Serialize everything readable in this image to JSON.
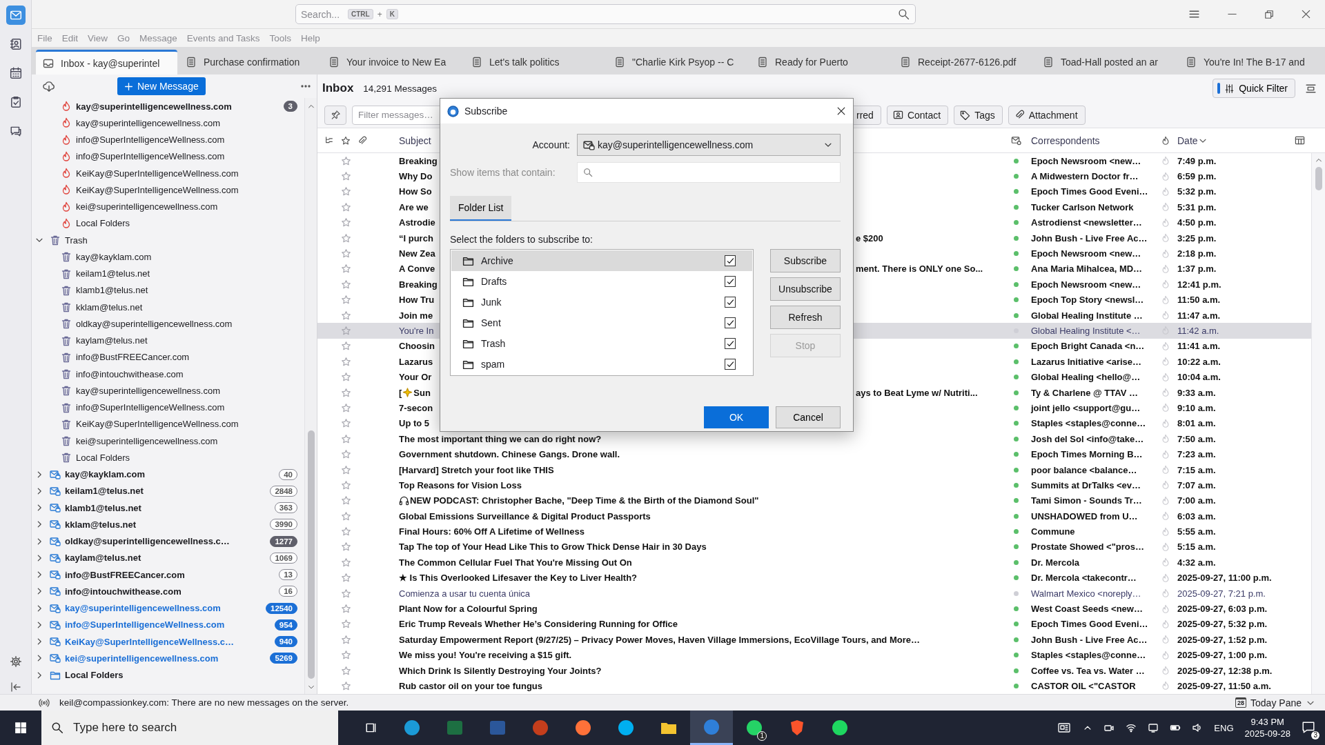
{
  "topbar": {
    "search_placeholder": "Search...",
    "shortcut": {
      "keys": [
        "CTRL",
        "K"
      ],
      "joiner": "+"
    }
  },
  "menu": [
    "File",
    "Edit",
    "View",
    "Go",
    "Message",
    "Events and Tasks",
    "Tools",
    "Help"
  ],
  "spaces_bar": {
    "items": [
      {
        "kind": "mail",
        "selected": true
      },
      {
        "kind": "contacts",
        "selected": false
      },
      {
        "kind": "calendar",
        "selected": false
      },
      {
        "kind": "tasks",
        "selected": false
      },
      {
        "kind": "chat",
        "selected": false
      }
    ]
  },
  "tabs": [
    {
      "kind": "folder",
      "label": "Inbox - kay@superintel",
      "selected": true
    },
    {
      "kind": "message",
      "label": "Purchase confirmation",
      "selected": false
    },
    {
      "kind": "message",
      "label": "Your invoice to New Ea",
      "selected": false
    },
    {
      "kind": "message",
      "label": "Let's talk politics",
      "selected": false
    },
    {
      "kind": "message",
      "label": "\"Charlie Kirk Psyop -- C",
      "selected": false
    },
    {
      "kind": "message",
      "label": "Ready for Puerto",
      "selected": false
    },
    {
      "kind": "message",
      "label": "Receipt-2677-6126.pdf",
      "selected": false
    },
    {
      "kind": "message",
      "label": "Toad-Hall posted an ar",
      "selected": false
    },
    {
      "kind": "message",
      "label": "You're In! The B-17 and",
      "selected": false
    }
  ],
  "folder_pane": {
    "new_message": "New Message",
    "folders": [
      {
        "children": [
          {
            "kind": "junk",
            "label": "kay@superintelligencewellness.com",
            "unread": true,
            "count": "3",
            "color": "#5f5f6a"
          },
          {
            "kind": "junk",
            "label": "kay@superintelligencewellness.com",
            "unread": false
          },
          {
            "kind": "junk",
            "label": "info@SuperIntelligenceWellness.com",
            "unread": false
          },
          {
            "kind": "junk",
            "label": "info@SuperIntelligenceWellness.com",
            "unread": false
          },
          {
            "kind": "junk",
            "label": "KeiKay@SuperIntelligenceWellness.com",
            "unread": false
          },
          {
            "kind": "junk",
            "label": "KeiKay@SuperIntelligenceWellness.com",
            "unread": false
          },
          {
            "kind": "junk",
            "label": "kei@superintelligencewellness.com",
            "unread": false
          },
          {
            "kind": "junk",
            "label": "Local Folders",
            "unread": false
          }
        ]
      },
      {
        "kind": "trash",
        "label": "Trash",
        "unread": false,
        "new_mail": false,
        "expanded": true,
        "children": [
          {
            "kind": "trash",
            "label": "kay@kayklam.com",
            "unread": false
          },
          {
            "kind": "trash",
            "label": "keilam1@telus.net",
            "unread": false
          },
          {
            "kind": "trash",
            "label": "klamb1@telus.net",
            "unread": false
          },
          {
            "kind": "trash",
            "label": "kklam@telus.net",
            "unread": false
          },
          {
            "kind": "trash",
            "label": "oldkay@superintelligencewellness.com",
            "unread": false
          },
          {
            "kind": "trash",
            "label": "kaylam@telus.net",
            "unread": false
          },
          {
            "kind": "trash",
            "label": "info@BustFREECancer.com",
            "unread": false
          },
          {
            "kind": "trash",
            "label": "info@intouchwithease.com",
            "unread": false
          },
          {
            "kind": "trash",
            "label": "kay@superintelligencewellness.com",
            "unread": false
          },
          {
            "kind": "trash",
            "label": "info@SuperIntelligenceWellness.com",
            "unread": false
          },
          {
            "kind": "trash",
            "label": "KeiKay@SuperIntelligenceWellness.com",
            "unread": false
          },
          {
            "kind": "trash",
            "label": "kei@superintelligencewellness.com",
            "unread": false
          },
          {
            "kind": "trash",
            "label": "Local Folders",
            "unread": false
          }
        ]
      },
      {
        "kind": "account",
        "label": "kay@kayklam.com",
        "unread": true,
        "new_mail": false,
        "expanded": false,
        "count": "40"
      },
      {
        "kind": "account",
        "label": "keilam1@telus.net",
        "unread": true,
        "new_mail": false,
        "expanded": false,
        "count": "2848"
      },
      {
        "kind": "account",
        "label": "klamb1@telus.net",
        "unread": true,
        "new_mail": false,
        "expanded": false,
        "count": "363"
      },
      {
        "kind": "account",
        "label": "kklam@telus.net",
        "unread": true,
        "new_mail": false,
        "expanded": false,
        "count": "3990"
      },
      {
        "kind": "account",
        "label": "oldkay@superintelligencewellness.c…",
        "unread": true,
        "new_mail": false,
        "expanded": false,
        "count": "1277",
        "color": "#5f5f6a"
      },
      {
        "kind": "account",
        "label": "kaylam@telus.net",
        "unread": true,
        "new_mail": false,
        "expanded": false,
        "count": "1069"
      },
      {
        "kind": "account",
        "label": "info@BustFREECancer.com",
        "unread": true,
        "new_mail": false,
        "expanded": false,
        "count": "13"
      },
      {
        "kind": "account",
        "label": "info@intouchwithease.com",
        "unread": true,
        "new_mail": false,
        "expanded": false,
        "count": "16"
      },
      {
        "kind": "account",
        "label": "kay@superintelligencewellness.com",
        "unread": true,
        "new_mail": true,
        "expanded": false,
        "count": "12540",
        "color": "#1b6fd6"
      },
      {
        "kind": "account",
        "label": "info@SuperIntelligenceWellness.com",
        "unread": true,
        "new_mail": true,
        "expanded": false,
        "count": "954",
        "color": "#1b6fd6"
      },
      {
        "kind": "account",
        "label": "KeiKay@SuperIntelligenceWellness.c…",
        "unread": true,
        "new_mail": true,
        "expanded": false,
        "count": "940",
        "color": "#1b6fd6"
      },
      {
        "kind": "account",
        "label": "kei@superintelligencewellness.com",
        "unread": true,
        "new_mail": true,
        "expanded": false,
        "count": "5269",
        "color": "#1b6fd6"
      },
      {
        "kind": "local",
        "label": "Local Folders",
        "unread": true,
        "new_mail": false,
        "expanded": false
      }
    ]
  },
  "message_pane": {
    "title": "Inbox",
    "count": "14,291 Messages",
    "quick_filter": {
      "label": "Quick Filter",
      "on": true
    },
    "filter_placeholder": "Filter messages…",
    "filter_buttons": [
      {
        "kind": "starred",
        "label": "rred"
      },
      {
        "kind": "contact",
        "label": "Contact"
      },
      {
        "kind": "tags",
        "label": "Tags"
      },
      {
        "kind": "attachment",
        "label": "Attachment"
      }
    ],
    "columns": {
      "subject": "Subject",
      "correspondents": "Correspondents",
      "date": "Date"
    },
    "rows": [
      {
        "kind": "text",
        "subject": "Breaking",
        "correspondent": "Epoch Newsroom <new…",
        "date": "7:49 p.m.",
        "unread": true,
        "selected": false
      },
      {
        "kind": "text",
        "subject": "Why Do",
        "correspondent": "A Midwestern Doctor fr…",
        "date": "6:59 p.m.",
        "unread": true,
        "selected": false
      },
      {
        "kind": "text",
        "subject": "How So",
        "correspondent": "Epoch Times Good Eveni…",
        "date": "5:32 p.m.",
        "unread": true,
        "selected": false
      },
      {
        "kind": "text",
        "subject": "Are we",
        "correspondent": "Tucker Carlson Network",
        "date": "5:31 p.m.",
        "unread": true,
        "selected": false
      },
      {
        "kind": "text",
        "subject": "Astrodie",
        "correspondent": "Astrodienst <newsletter…",
        "date": "4:50 p.m.",
        "unread": true,
        "selected": false
      },
      {
        "kind": "text",
        "subject": "“I purch",
        "tail": "e $200",
        "correspondent": "John Bush - Live Free Ac…",
        "date": "3:25 p.m.",
        "unread": true,
        "selected": false
      },
      {
        "kind": "text",
        "subject": "New Zea",
        "correspondent": "Epoch Newsroom <new…",
        "date": "2:18 p.m.",
        "unread": true,
        "selected": false
      },
      {
        "kind": "text",
        "subject": "A Conve",
        "tail": "ment. There is ONLY one So...",
        "correspondent": "Ana Maria Mihalcea, MD…",
        "date": "1:37 p.m.",
        "unread": true,
        "selected": false
      },
      {
        "kind": "text",
        "subject": "Breaking",
        "correspondent": "Epoch Newsroom <new…",
        "date": "12:41 p.m.",
        "unread": true,
        "selected": false
      },
      {
        "kind": "text",
        "subject": "How Tru",
        "correspondent": "Epoch Top Story <newsl…",
        "date": "11:50 a.m.",
        "unread": true,
        "selected": false
      },
      {
        "kind": "text",
        "subject": "Join me",
        "correspondent": "Global Healing Institute …",
        "date": "11:47 a.m.",
        "unread": true,
        "selected": false
      },
      {
        "kind": "text",
        "subject": "You're In",
        "correspondent": "Global Healing Institute <…",
        "date": "11:42 a.m.",
        "unread": false,
        "selected": true
      },
      {
        "kind": "text",
        "subject": "Choosin",
        "correspondent": "Epoch Bright Canada <n…",
        "date": "11:41 a.m.",
        "unread": true,
        "selected": false
      },
      {
        "kind": "text",
        "subject": "Lazarus",
        "correspondent": "Lazarus Initiative <arise…",
        "date": "10:22 a.m.",
        "unread": true,
        "selected": false
      },
      {
        "kind": "text",
        "subject": "Your Or",
        "correspondent": "Global Healing <hello@…",
        "date": "10:04 a.m.",
        "unread": true,
        "selected": false
      },
      {
        "kind": "sparkle",
        "lead": "[",
        "subject": "Sun",
        "tail": "ays to Beat Lyme w/ Nutriti...",
        "correspondent": "Ty & Charlene @ TTAV …",
        "date": "9:33 a.m.",
        "unread": true,
        "selected": false
      },
      {
        "kind": "text",
        "subject": "7-secon",
        "correspondent": "joint jello <support@gu…",
        "date": "9:10 a.m.",
        "unread": true,
        "selected": false
      },
      {
        "kind": "text",
        "subject": "Up to 5",
        "correspondent": "Staples <staples@conne…",
        "date": "8:01 a.m.",
        "unread": true,
        "selected": false
      },
      {
        "kind": "text",
        "subject": "The most important thing we can do right now?",
        "correspondent": "Josh del Sol <info@take…",
        "date": "7:50 a.m.",
        "unread": true,
        "selected": false
      },
      {
        "kind": "text",
        "subject": "Government shutdown. Chinese Gangs. Drone wall.",
        "correspondent": "Epoch Times Morning B…",
        "date": "7:23 a.m.",
        "unread": true,
        "selected": false
      },
      {
        "kind": "text",
        "subject": "[Harvard] Stretch your foot like THIS",
        "correspondent": "poor balance <balance…",
        "date": "7:15 a.m.",
        "unread": true,
        "selected": false
      },
      {
        "kind": "text",
        "subject": "Top Reasons for Vision Loss",
        "correspondent": "Summits at DrTalks <ev…",
        "date": "7:07 a.m.",
        "unread": true,
        "selected": false
      },
      {
        "kind": "headphones",
        "subject": "NEW PODCAST: Christopher Bache, \"Deep Time & the Birth of the Diamond Soul\"",
        "correspondent": "Tami Simon - Sounds Tr…",
        "date": "7:00 a.m.",
        "unread": true,
        "selected": false
      },
      {
        "kind": "text",
        "subject": "Global Emissions Surveillance & Digital Product Passports",
        "correspondent": "UNSHADOWED from U…",
        "date": "6:03 a.m.",
        "unread": true,
        "selected": false
      },
      {
        "kind": "text",
        "subject": "Final Hours: 60% Off A Lifetime of Wellness",
        "correspondent": "Commune",
        "date": "5:55 a.m.",
        "unread": true,
        "selected": false
      },
      {
        "kind": "text",
        "subject": "Tap The top of Your Head Like This to Grow Thick Dense Hair in 30 Days",
        "correspondent": "Prostate Showed <\"pros…",
        "date": "5:15 a.m.",
        "unread": true,
        "selected": false
      },
      {
        "kind": "text",
        "subject": "The Common Cellular Fuel That You're Missing Out On",
        "correspondent": "Dr. Mercola",
        "date": "4:32 a.m.",
        "unread": true,
        "selected": false
      },
      {
        "kind": "text",
        "subject": "★ Is This Overlooked Lifesaver the Key to Liver Health?",
        "correspondent": "Dr. Mercola <takecontr…",
        "date": "2025-09-27, 11:00 p.m.",
        "unread": true,
        "selected": false
      },
      {
        "kind": "text",
        "subject": "Comienza a usar tu cuenta única",
        "correspondent": "Walmart Mexico <noreply…",
        "date": "2025-09-27, 7:21 p.m.",
        "unread": false,
        "selected": false
      },
      {
        "kind": "text",
        "subject": "Plant Now for a Colourful Spring",
        "correspondent": "West Coast Seeds <new…",
        "date": "2025-09-27, 6:03 p.m.",
        "unread": true,
        "selected": false
      },
      {
        "kind": "text",
        "subject": "Eric Trump Reveals Whether He’s Considering Running for Office",
        "correspondent": "Epoch Times Good Eveni…",
        "date": "2025-09-27, 5:32 p.m.",
        "unread": true,
        "selected": false
      },
      {
        "kind": "text",
        "subject": "Saturday Empowerment Report (9/27/25) – Privacy Power Moves, Haven Village Immersions, EcoVillage Tours, and More…",
        "correspondent": "John Bush - Live Free Ac…",
        "date": "2025-09-27, 1:52 p.m.",
        "unread": true,
        "selected": false
      },
      {
        "kind": "text",
        "subject": "We miss you! You're receiving a $15 gift.",
        "correspondent": "Staples <staples@conne…",
        "date": "2025-09-27, 1:00 p.m.",
        "unread": true,
        "selected": false
      },
      {
        "kind": "text",
        "subject": "Which Drink Is Silently Destroying Your Joints?",
        "correspondent": "Coffee vs. Tea vs. Water …",
        "date": "2025-09-27, 12:38 p.m.",
        "unread": true,
        "selected": false
      },
      {
        "kind": "text",
        "subject": "Rub castor oil on your toe fungus",
        "correspondent": "CASTOR OIL <\"CASTOR",
        "date": "2025-09-27, 11:50 a.m.",
        "unread": true,
        "selected": false
      }
    ]
  },
  "dialog": {
    "title": "Subscribe",
    "account_label": "Account:",
    "account": "kay@superintelligencewellness.com",
    "filter_label": "Show items that contain:",
    "tabs": [
      {
        "label": "Folder List",
        "selected": true
      }
    ],
    "instruction": "Select the folders to subscribe to:",
    "folders": [
      {
        "label": "Archive",
        "checked": true,
        "selected": true
      },
      {
        "label": "Drafts",
        "checked": true,
        "selected": false
      },
      {
        "label": "Junk",
        "checked": true,
        "selected": false
      },
      {
        "label": "Sent",
        "checked": true,
        "selected": false
      },
      {
        "label": "Trash",
        "checked": true,
        "selected": false
      },
      {
        "label": "spam",
        "checked": true,
        "selected": false
      }
    ],
    "buttons": [
      {
        "label": "Subscribe",
        "disabled": false
      },
      {
        "label": "Unsubscribe",
        "disabled": false
      },
      {
        "label": "Refresh",
        "disabled": false
      },
      {
        "label": "Stop",
        "disabled": true
      }
    ],
    "ok": "OK",
    "cancel": "Cancel"
  },
  "status_bar": {
    "message": "keil@compassionkey.com: There are no new messages on the server.",
    "today_day": "28",
    "today_pane": "Today Pane"
  },
  "taskbar": {
    "search_placeholder": "Type here to search",
    "apps": [
      {
        "kind": "circle",
        "color": "#1b9ad6",
        "selected": false
      },
      {
        "kind": "tile",
        "color": "#1d6f42",
        "selected": false
      },
      {
        "kind": "tile",
        "color": "#2b579a",
        "selected": false
      },
      {
        "kind": "circle",
        "color": "#c43e1c",
        "selected": false
      },
      {
        "kind": "circle",
        "color": "#ff7139",
        "selected": false
      },
      {
        "kind": "circle",
        "color": "#00aff0",
        "selected": false
      },
      {
        "kind": "folder",
        "color": "#f4c430",
        "selected": false
      },
      {
        "kind": "circle",
        "color": "#2f7fd8",
        "selected": true
      },
      {
        "kind": "circle",
        "color": "#25d366",
        "selected": false,
        "badge": "1"
      },
      {
        "kind": "shield",
        "color": "#fb542b",
        "selected": false
      },
      {
        "kind": "circle",
        "color": "#1ed760",
        "selected": false
      }
    ],
    "language": "ENG",
    "time": "9:43 PM",
    "date": "2025-09-28",
    "notifications": "3"
  }
}
